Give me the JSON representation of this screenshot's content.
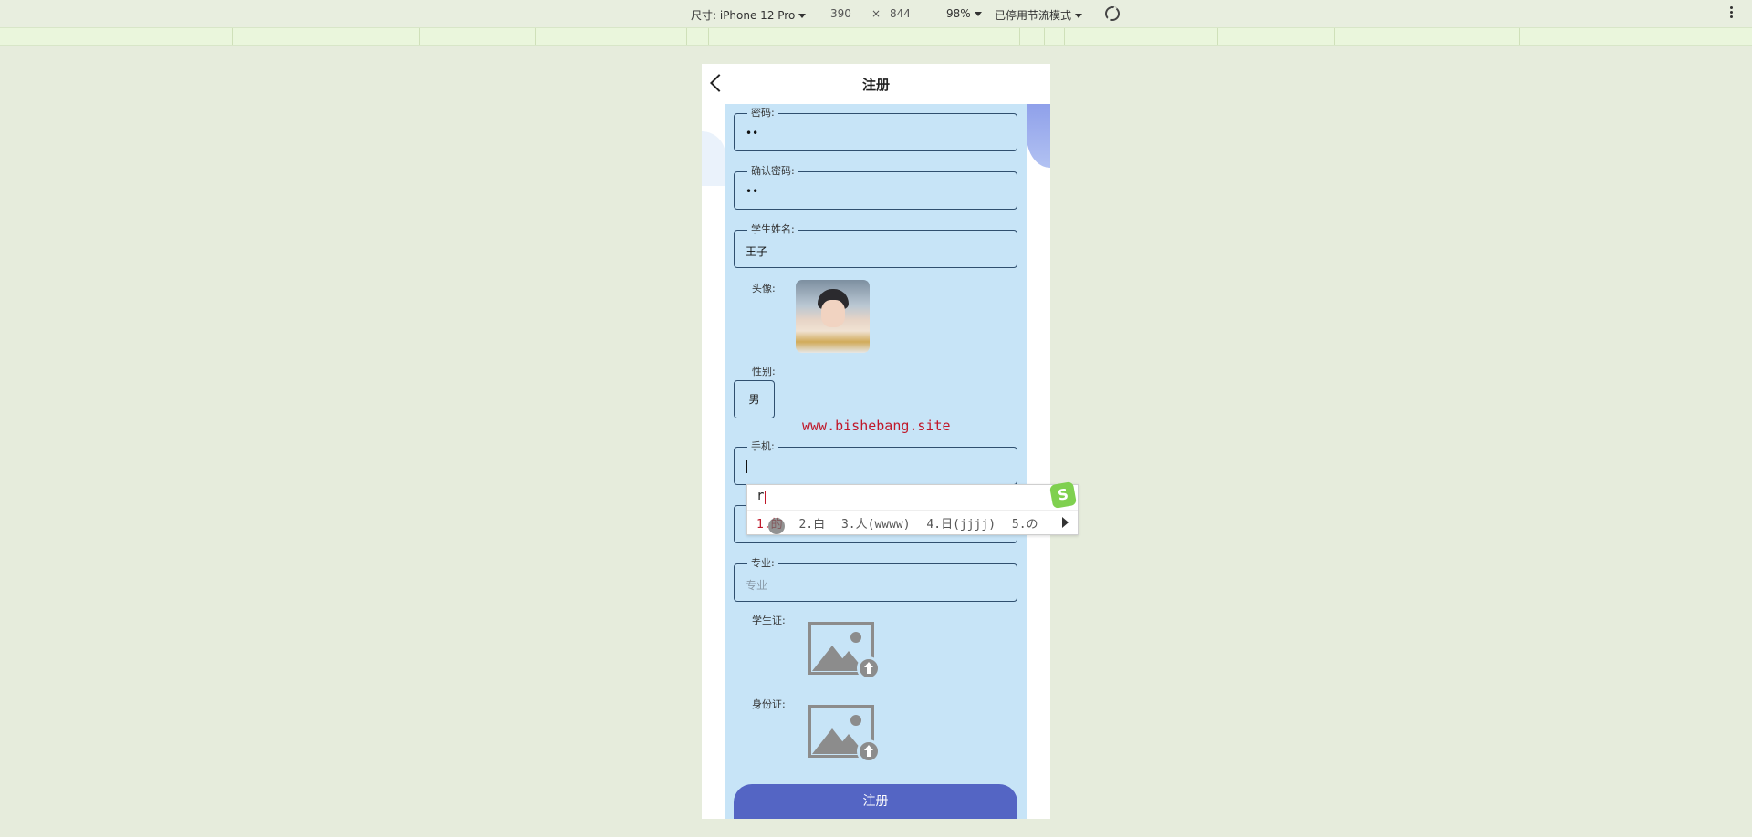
{
  "devtools": {
    "device": "尺寸: iPhone 12 Pro",
    "width": "390",
    "times": "×",
    "height": "844",
    "zoom": "98%",
    "throttle": "已停用节流模式"
  },
  "page": {
    "title": "注册",
    "watermark": "www.bishebang.site",
    "fields": {
      "password": {
        "label": "密码:",
        "value": "••"
      },
      "confirm": {
        "label": "确认密码:",
        "value": "••"
      },
      "name": {
        "label": "学生姓名:",
        "value": "王子"
      },
      "phone": {
        "label": "手机:"
      },
      "major": {
        "label": "专业:",
        "placeholder": "专业"
      }
    },
    "avatar_label": "头像:",
    "gender_label": "性别:",
    "gender_value": "男",
    "student_card_label": "学生证:",
    "id_card_label": "身份证:",
    "submit": "注册"
  },
  "ime": {
    "composition": "r",
    "candidates": [
      "1.的",
      "2.白",
      "3.人(wwww)",
      "4.日(jjjj)",
      "5.の"
    ],
    "logo": "S"
  },
  "icons": [
    "back-icon",
    "caret-down-icon",
    "rotate-icon",
    "more-vert-icon",
    "upload-image-icon",
    "next-page-icon"
  ]
}
